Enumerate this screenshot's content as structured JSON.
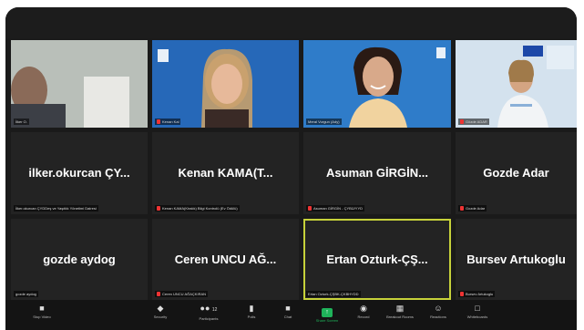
{
  "participants": [
    {
      "display": "",
      "caption": "İlker O.",
      "video": true,
      "muted": false
    },
    {
      "display": "",
      "caption": "Kenan Kal",
      "video": true,
      "muted": true
    },
    {
      "display": "",
      "caption": "Meral Vurgun (Ady)",
      "video": true,
      "muted": false
    },
    {
      "display": "",
      "caption": "Gözde ADAR",
      "video": true,
      "muted": true
    },
    {
      "display": "ilker.okurcan ÇY...",
      "caption": "İlker.okurcan ÇYDDeş ve Yaşıtlık Yönetimi Dairesi",
      "video": false,
      "muted": false
    },
    {
      "display": "Kenan KAMA(T...",
      "caption": "Kenan KAMA(Kiralık) Bilgi Kontrolü (Ev Ödülü)",
      "video": false,
      "muted": true
    },
    {
      "display": "Asuman GİRGİN...",
      "caption": "Asuman GİRGİN - ÇYBÜ/YYD",
      "video": false,
      "muted": true
    },
    {
      "display": "Gozde Adar",
      "caption": "Gozde Adar",
      "video": false,
      "muted": true
    },
    {
      "display": "gozde aydog",
      "caption": "gozde aydog",
      "video": false,
      "muted": false
    },
    {
      "display": "Ceren UNCU AĞ...",
      "caption": "Ceren UNCU AĞAÇKIRAN",
      "video": false,
      "muted": true
    },
    {
      "display": "Ertan Ozturk-ÇŞ...",
      "caption": "Ertan Ozturk-ÇŞBK-ÇKBHYDD",
      "video": false,
      "muted": false,
      "active": true
    },
    {
      "display": "Bursev Artukoglu",
      "caption": "Bursev Artukoglu",
      "video": false,
      "muted": true
    }
  ],
  "toolbar": {
    "stop_video": "Stop Video",
    "security": "Security",
    "participants": "Participants",
    "participants_count": "12",
    "polls": "Polls",
    "chat": "Chat",
    "share_screen": "Share Screen",
    "record": "Record",
    "breakout_rooms": "Breakout Rooms",
    "reactions": "Reactions",
    "whiteboards": "Whiteboards"
  },
  "colors": {
    "active_border": "#c7d23a",
    "share_green": "#1fb35a",
    "muted_red": "#e33"
  }
}
